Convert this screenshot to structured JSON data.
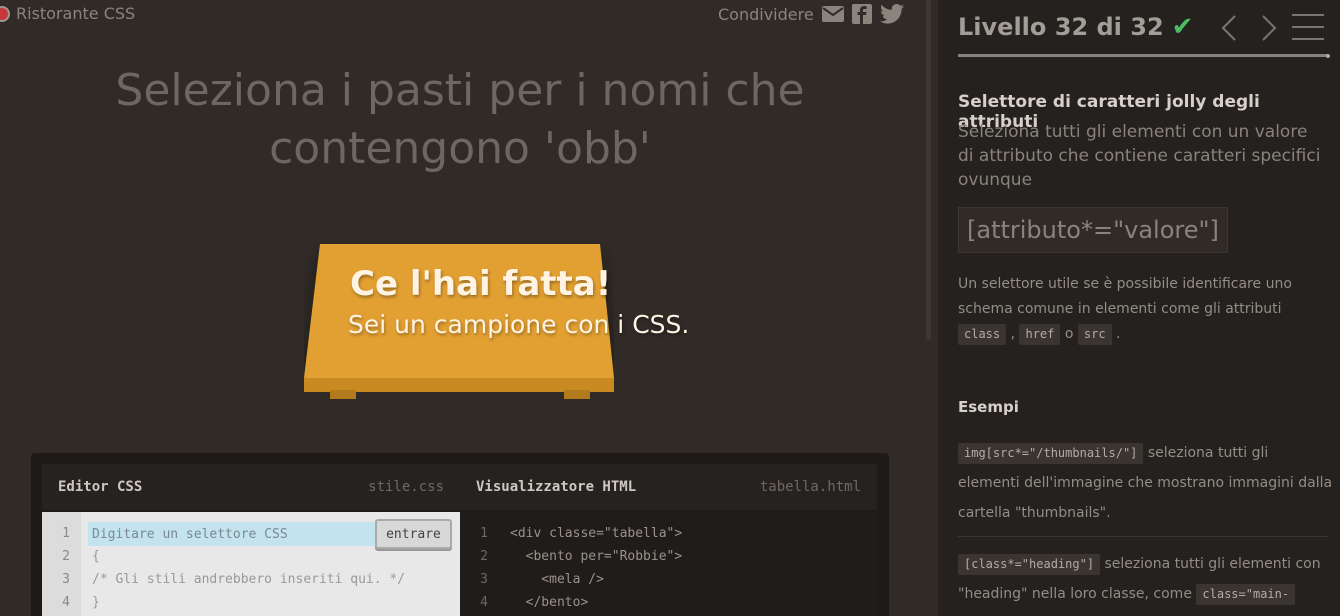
{
  "app": {
    "title": "Ristorante CSS",
    "share_label": "Condividere"
  },
  "icons": {
    "mail": "mail-icon",
    "facebook": "facebook-icon",
    "twitter": "twitter-icon",
    "check": "check-icon",
    "prev": "chevron-left-icon",
    "next": "chevron-right-icon",
    "menu": "menu-icon"
  },
  "colors": {
    "accent": "#4cbb62",
    "table": "#e3a030",
    "logo_dot": "#c9373c"
  },
  "order": {
    "line1": "Seleziona i pasti per i nomi che",
    "line2": "contengono 'obb'"
  },
  "win": {
    "title": "Ce l'hai fatta!",
    "subtitle": "Sei un campione con i CSS."
  },
  "editor": {
    "css_title": "Editor CSS",
    "css_file": "stile.css",
    "input_placeholder": "Digitare un selettore CSS",
    "enter_label": "entrare",
    "css_lines": [
      "1",
      "2",
      "3",
      "4"
    ],
    "css_code": [
      "{",
      "/* Gli stili andrebbero inseriti qui. */",
      "}"
    ],
    "html_title": "Visualizzatore HTML",
    "html_file": "tabella.html",
    "html_lines": [
      "1",
      "2",
      "3",
      "4"
    ],
    "html_code": [
      "<div classe=\"tabella\">",
      "  <bento per=\"Robbie\">",
      "    <mela />",
      "  </bento>"
    ]
  },
  "sidebar": {
    "level_label": "Livello 32 di 32",
    "progress": 1.0,
    "selector_name": "Selettore di caratteri jolly degli attributi",
    "selector_desc": "Seleziona tutti gli elementi con un valore di attributo che contiene caratteri specifici ovunque",
    "syntax": "[attributo*=\"valore\"]",
    "hint_text": "Un selettore utile se è possibile identificare uno schema comune in elementi come gli attributi",
    "hint_tags": [
      "class",
      "href",
      "src"
    ],
    "hint_sep1": ",",
    "hint_sep2": "o",
    "hint_end": ".",
    "examples_title": "Esempi",
    "example1_code": "img[src*=\"/thumbnails/\"]",
    "example1_text": "seleziona tutti gli elementi dell'immagine che mostrano immagini dalla cartella \"thumbnails\".",
    "example2_code": "[class*=\"heading\"]",
    "example2_text": "seleziona tutti gli elementi con \"heading\" nella loro classe, come",
    "example2_code2": "class=\"main-"
  }
}
